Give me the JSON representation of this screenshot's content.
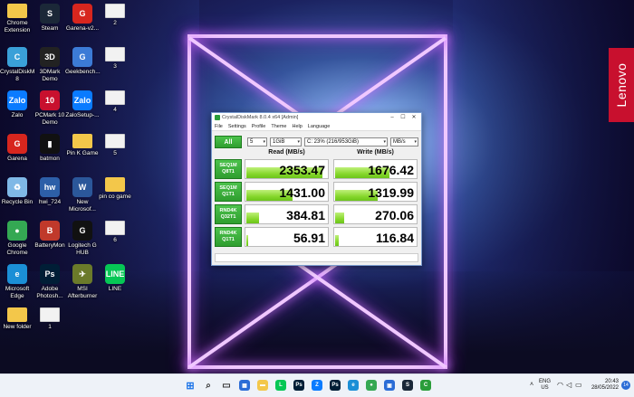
{
  "brand": {
    "lenovo": "Lenovo"
  },
  "desktop_icons": [
    {
      "label": "Chrome\nExtension",
      "icon": "folder-icon",
      "color": "#f3c74a",
      "glyph": ""
    },
    {
      "label": "Steam",
      "icon": "steam-icon",
      "color": "#1b2838",
      "glyph": "S"
    },
    {
      "label": "Garena-v2...",
      "icon": "garena-icon",
      "color": "#d7261e",
      "glyph": "G"
    },
    {
      "label": "2",
      "icon": "file-icon",
      "color": "#f2f2f2",
      "glyph": ""
    },
    {
      "label": "CrystalDiskM\n8",
      "icon": "crystaldiskmark-icon",
      "color": "#3aa0d8",
      "glyph": "C"
    },
    {
      "label": "3DMark\nDemo",
      "icon": "3dmark-icon",
      "color": "#222222",
      "glyph": "3D"
    },
    {
      "label": "Geekbench...",
      "icon": "geekbench-icon",
      "color": "#3c7bd6",
      "glyph": "G"
    },
    {
      "label": "3",
      "icon": "file-icon",
      "color": "#f2f2f2",
      "glyph": ""
    },
    {
      "label": "Zalo",
      "icon": "zalo-icon",
      "color": "#0a7bff",
      "glyph": "Zalo"
    },
    {
      "label": "PCMark 10\nDemo",
      "icon": "pcmark-icon",
      "color": "#c8102e",
      "glyph": "10"
    },
    {
      "label": "ZaloSetup-...",
      "icon": "zalo-setup-icon",
      "color": "#0a7bff",
      "glyph": "Zalo"
    },
    {
      "label": "4",
      "icon": "file-icon",
      "color": "#f2f2f2",
      "glyph": ""
    },
    {
      "label": "Garena",
      "icon": "garena-icon",
      "color": "#d7261e",
      "glyph": "G"
    },
    {
      "label": "batmon",
      "icon": "batmon-icon",
      "color": "#111111",
      "glyph": "▮"
    },
    {
      "label": "Pin K Game",
      "icon": "folder-icon",
      "color": "#f3c74a",
      "glyph": ""
    },
    {
      "label": "5",
      "icon": "file-icon",
      "color": "#f2f2f2",
      "glyph": ""
    },
    {
      "label": "Recycle Bin",
      "icon": "recycle-bin-icon",
      "color": "#7fb8e6",
      "glyph": "♻"
    },
    {
      "label": "hwi_724",
      "icon": "hwinfo-icon",
      "color": "#2d5fa8",
      "glyph": "hw"
    },
    {
      "label": "New\nMicrosof...",
      "icon": "word-icon",
      "color": "#2b579a",
      "glyph": "W"
    },
    {
      "label": "pin co game",
      "icon": "folder-icon",
      "color": "#f3c74a",
      "glyph": ""
    },
    {
      "label": "Google\nChrome",
      "icon": "chrome-icon",
      "color": "#34a853",
      "glyph": "●"
    },
    {
      "label": "BatteryMon",
      "icon": "batterymon-icon",
      "color": "#c0392b",
      "glyph": "B"
    },
    {
      "label": "Logitech G\nHUB",
      "icon": "logitech-icon",
      "color": "#111111",
      "glyph": "G"
    },
    {
      "label": "6",
      "icon": "file-icon",
      "color": "#f2f2f2",
      "glyph": ""
    },
    {
      "label": "Microsoft\nEdge",
      "icon": "edge-icon",
      "color": "#1b8fd6",
      "glyph": "e"
    },
    {
      "label": "Adobe\nPhotosh...",
      "icon": "photoshop-icon",
      "color": "#001e36",
      "glyph": "Ps"
    },
    {
      "label": "MSI\nAfterburner",
      "icon": "afterburner-icon",
      "color": "#6b7a2a",
      "glyph": "✈"
    },
    {
      "label": "LINE",
      "icon": "line-icon",
      "color": "#06c755",
      "glyph": "LINE"
    },
    {
      "label": "New folder",
      "icon": "folder-icon",
      "color": "#f3c74a",
      "glyph": ""
    },
    {
      "label": "1",
      "icon": "file-icon",
      "color": "#f2f2f2",
      "glyph": ""
    }
  ],
  "cdm": {
    "title": "CrystalDiskMark 8.0.4 x64 [Admin]",
    "menu": [
      "File",
      "Settings",
      "Profile",
      "Theme",
      "Help",
      "Language"
    ],
    "all_button": "All",
    "count": "5",
    "size": "1GiB",
    "drive": "C: 23% (216/953GiB)",
    "unit": "MB/s",
    "read_header": "Read (MB/s)",
    "write_header": "Write (MB/s)",
    "max_scale": 2500,
    "rows": [
      {
        "line1": "SEQ1M",
        "line2": "Q8T1",
        "read": "2353.47",
        "write": "1676.42",
        "read_num": 2353.47,
        "write_num": 1676.42
      },
      {
        "line1": "SEQ1M",
        "line2": "Q1T1",
        "read": "1431.00",
        "write": "1319.99",
        "read_num": 1431.0,
        "write_num": 1319.99
      },
      {
        "line1": "RND4K",
        "line2": "Q32T1",
        "read": "384.81",
        "write": "270.06",
        "read_num": 384.81,
        "write_num": 270.06
      },
      {
        "line1": "RND4K",
        "line2": "Q1T1",
        "read": "56.91",
        "write": "116.84",
        "read_num": 56.91,
        "write_num": 116.84
      }
    ]
  },
  "taskbar": {
    "apps": [
      {
        "name": "windows-start-icon",
        "color": "#1a73e8",
        "glyph": "⊞"
      },
      {
        "name": "search-icon",
        "color": "#333333",
        "glyph": "⌕"
      },
      {
        "name": "task-view-icon",
        "color": "#333333",
        "glyph": "▭"
      },
      {
        "name": "widgets-icon",
        "color": "#2b6cd6",
        "glyph": "▦"
      },
      {
        "name": "file-explorer-icon",
        "color": "#f3c74a",
        "glyph": "▬"
      },
      {
        "name": "line-icon",
        "color": "#06c755",
        "glyph": "L"
      },
      {
        "name": "photoshop-icon",
        "color": "#001e36",
        "glyph": "Ps"
      },
      {
        "name": "zalo-icon",
        "color": "#0a7bff",
        "glyph": "Z"
      },
      {
        "name": "photoshop-icon-2",
        "color": "#001e36",
        "glyph": "Ps"
      },
      {
        "name": "edge-icon",
        "color": "#1b8fd6",
        "glyph": "e"
      },
      {
        "name": "chrome-icon",
        "color": "#34a853",
        "glyph": "●"
      },
      {
        "name": "store-icon",
        "color": "#2b6cd6",
        "glyph": "▣"
      },
      {
        "name": "steam-icon",
        "color": "#1b2838",
        "glyph": "S"
      },
      {
        "name": "cdm-taskbar-icon",
        "color": "#2a9d3a",
        "glyph": "C"
      }
    ],
    "lang": "ENG",
    "region": "US",
    "time": "20:43",
    "date": "28/05/2022",
    "notification_count": "14"
  }
}
